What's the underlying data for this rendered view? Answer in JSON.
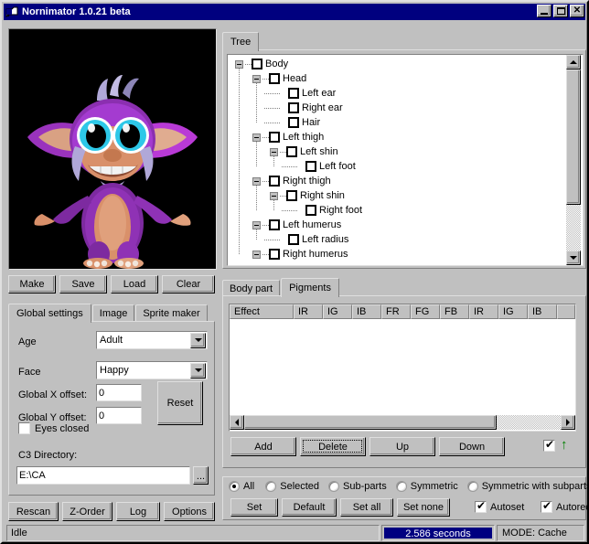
{
  "window": {
    "title": "Nornimator 1.0.21 beta",
    "icon": "creature-window-icon",
    "buttons": {
      "minimize": "_",
      "maximize": "❐",
      "close": "✕"
    }
  },
  "preview": {
    "name": "creature-preview",
    "background": "#000000",
    "creature_colors": {
      "body_purple": "#8b2fb0",
      "body_purple_light": "#c04fe0",
      "skin_tan": "#d9906a",
      "skin_tan_light": "#e8b394",
      "hair_lavender": "#b0a8d8",
      "eye_cyan": "#2ec8e8",
      "eye_white": "#ffffff",
      "teeth_white": "#f2f2f2"
    }
  },
  "left_buttons": [
    "Make",
    "Save",
    "Load",
    "Clear"
  ],
  "left_tabs": [
    {
      "label": "Global settings",
      "active": true
    },
    {
      "label": "Image",
      "active": false
    },
    {
      "label": "Sprite maker",
      "active": false
    }
  ],
  "global_settings": {
    "age_label": "Age",
    "age_value": "Adult",
    "age_options": [
      "Adult"
    ],
    "face_label": "Face",
    "face_value": "Happy",
    "face_options": [
      "Happy"
    ],
    "x_offset_label": "Global X offset:",
    "x_offset_value": "0",
    "y_offset_label": "Global Y offset:",
    "y_offset_value": "0",
    "reset_label": "Reset",
    "eyes_closed_label": "Eyes closed",
    "eyes_closed_checked": false,
    "c3_dir_label": "C3 Directory:",
    "c3_dir_value": "E:\\CA",
    "browse_label": "..."
  },
  "bottom_left_buttons": [
    "Rescan",
    "Z-Order",
    "Log",
    "Options"
  ],
  "tree_panel": {
    "tabs": [
      {
        "label": "Tree",
        "active": true
      }
    ],
    "nodes": [
      {
        "label": "Body",
        "depth": 0,
        "expander": true,
        "checked": false
      },
      {
        "label": "Head",
        "depth": 1,
        "expander": true,
        "checked": false
      },
      {
        "label": "Left ear",
        "depth": 2,
        "expander": false,
        "checked": false
      },
      {
        "label": "Right ear",
        "depth": 2,
        "expander": false,
        "checked": false
      },
      {
        "label": "Hair",
        "depth": 2,
        "expander": false,
        "checked": false
      },
      {
        "label": "Left thigh",
        "depth": 1,
        "expander": true,
        "checked": false
      },
      {
        "label": "Left shin",
        "depth": 2,
        "expander": true,
        "checked": false
      },
      {
        "label": "Left foot",
        "depth": 3,
        "expander": false,
        "checked": false
      },
      {
        "label": "Right thigh",
        "depth": 1,
        "expander": true,
        "checked": false
      },
      {
        "label": "Right shin",
        "depth": 2,
        "expander": true,
        "checked": false
      },
      {
        "label": "Right foot",
        "depth": 3,
        "expander": false,
        "checked": false
      },
      {
        "label": "Left humerus",
        "depth": 1,
        "expander": true,
        "checked": false
      },
      {
        "label": "Left radius",
        "depth": 2,
        "expander": false,
        "checked": false
      },
      {
        "label": "Right humerus",
        "depth": 1,
        "expander": true,
        "checked": false
      }
    ],
    "scrollbar": {
      "up": "▲",
      "down": "▼",
      "thumb_percent": 75
    }
  },
  "part_panel": {
    "tabs": [
      {
        "label": "Body part",
        "active": false
      },
      {
        "label": "Pigments",
        "active": true
      }
    ],
    "list": {
      "columns": [
        "Effect",
        "IR",
        "IG",
        "IB",
        "FR",
        "FG",
        "FB",
        "IR",
        "IG",
        "IB"
      ],
      "rows": [],
      "hscroll": {
        "left": "◀",
        "right": "▶",
        "thumb_percent": 80
      }
    },
    "buttons": [
      {
        "label": "Add",
        "focused": false
      },
      {
        "label": "Delete",
        "focused": true
      },
      {
        "label": "Up",
        "focused": false
      },
      {
        "label": "Down",
        "focused": false
      }
    ],
    "move_checkbox_checked": true,
    "move_arrow_icon": "up-arrow-icon",
    "move_arrow_color": "#008000"
  },
  "apply_panel": {
    "radios": [
      {
        "label": "All",
        "checked": true
      },
      {
        "label": "Selected",
        "checked": false
      },
      {
        "label": "Sub-parts",
        "checked": false
      },
      {
        "label": "Symmetric",
        "checked": false
      },
      {
        "label": "Symmetric with subparts",
        "checked": false
      }
    ],
    "buttons": [
      "Set",
      "Default",
      "Set all",
      "Set none"
    ],
    "checkboxes": [
      {
        "label": "Autoset",
        "checked": true
      },
      {
        "label": "Autoredraw",
        "checked": true
      }
    ]
  },
  "statusbar": {
    "status": "Idle",
    "timer": "2.586 seconds",
    "timer_bg": "#000080",
    "timer_fg": "#ffffff",
    "mode": "MODE: Cache"
  }
}
